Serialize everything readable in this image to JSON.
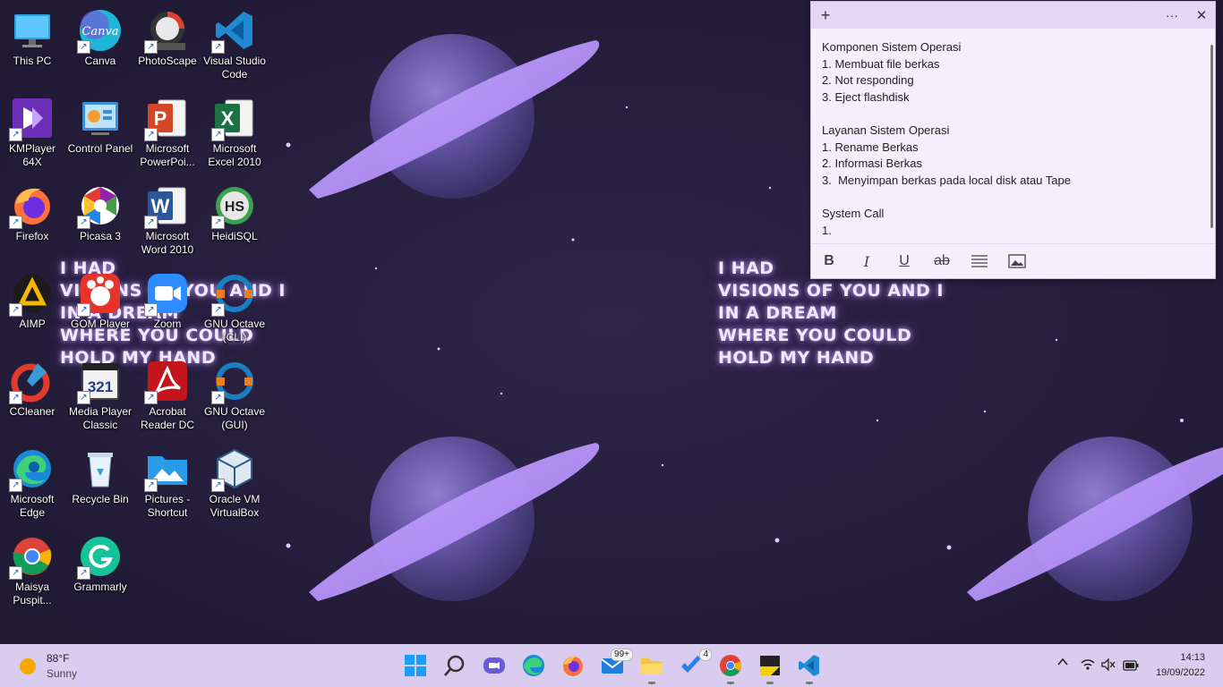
{
  "wallpaper": {
    "left_text": "I HAD\nVISIONS OF YOU AND I\nIN A DREAM\nWHERE YOU COULD\nHOLD MY HAND",
    "right_text": "I HAD\nVISIONS OF YOU AND I\nIN A DREAM\nWHERE YOU COULD\nHOLD MY HAND"
  },
  "desktop_icons": [
    {
      "label": "This PC",
      "icon": "computer-icon"
    },
    {
      "label": "Canva",
      "icon": "canva-icon"
    },
    {
      "label": "PhotoScape",
      "icon": "photoscape-icon"
    },
    {
      "label": "Visual Studio Code",
      "icon": "vscode-icon"
    },
    {
      "label": "KMPlayer 64X",
      "icon": "kmplayer-icon"
    },
    {
      "label": "Control Panel",
      "icon": "control-panel-icon"
    },
    {
      "label": "Microsoft PowerPoi...",
      "icon": "powerpoint-icon"
    },
    {
      "label": "Microsoft Excel 2010",
      "icon": "excel-icon"
    },
    {
      "label": "Firefox",
      "icon": "firefox-icon"
    },
    {
      "label": "Picasa 3",
      "icon": "picasa-icon"
    },
    {
      "label": "Microsoft Word 2010",
      "icon": "word-icon"
    },
    {
      "label": "HeidiSQL",
      "icon": "heidisql-icon"
    },
    {
      "label": "AIMP",
      "icon": "aimp-icon"
    },
    {
      "label": "GOM Player",
      "icon": "gom-player-icon"
    },
    {
      "label": "Zoom",
      "icon": "zoom-icon"
    },
    {
      "label": "GNU Octave (CLI)",
      "icon": "octave-icon"
    },
    {
      "label": "CCleaner",
      "icon": "ccleaner-icon"
    },
    {
      "label": "Media Player Classic",
      "icon": "media-player-classic-icon"
    },
    {
      "label": "Acrobat Reader DC",
      "icon": "acrobat-icon"
    },
    {
      "label": "GNU Octave (GUI)",
      "icon": "octave-icon"
    },
    {
      "label": "Microsoft Edge",
      "icon": "edge-icon"
    },
    {
      "label": "Recycle Bin",
      "icon": "recycle-bin-icon"
    },
    {
      "label": "Pictures - Shortcut",
      "icon": "pictures-folder-icon"
    },
    {
      "label": "Oracle VM VirtualBox",
      "icon": "virtualbox-icon"
    },
    {
      "label": "Maisya Puspit...",
      "icon": "chrome-icon"
    },
    {
      "label": "Grammarly",
      "icon": "grammarly-icon"
    }
  ],
  "sticky_note": {
    "lines": [
      "Komponen Sistem Operasi",
      "1. Membuat file berkas",
      "2. Not responding",
      "3. Eject flashdisk",
      "",
      "Layanan Sistem Operasi",
      "1. Rename Berkas",
      "2. Informasi Berkas",
      "3.  Menyimpan berkas pada local disk atau Tape",
      "",
      "System Call",
      "1. "
    ],
    "titlebar": {
      "new": "+",
      "menu": "···",
      "close": "✕"
    },
    "format": {
      "bold": "B",
      "italic": "I",
      "underline": "U",
      "strike": "ab"
    }
  },
  "taskbar": {
    "weather": {
      "temp": "88°F",
      "condition": "Sunny"
    },
    "mail_badge": "99+",
    "todo_badge": "4",
    "clock": {
      "time": "14:13",
      "date": "19/09/2022"
    },
    "accent": "#d9ccef"
  }
}
